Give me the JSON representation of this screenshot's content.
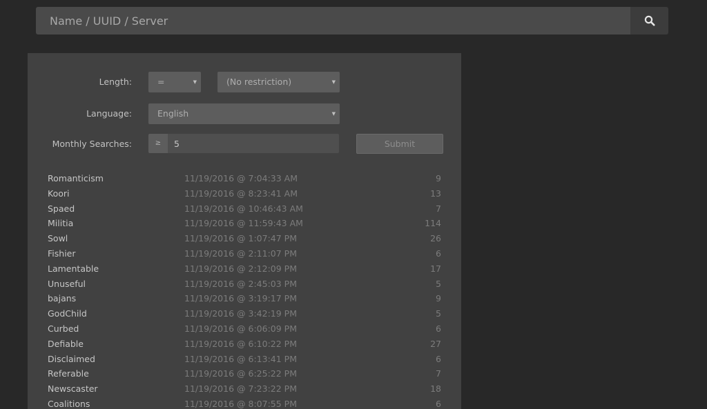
{
  "search": {
    "placeholder": "Name / UUID / Server",
    "icon": "search-icon"
  },
  "filters": {
    "length_label": "Length:",
    "length_operator": "=",
    "length_value": "(No restriction)",
    "language_label": "Language:",
    "language_value": "English",
    "monthly_label": "Monthly Searches:",
    "monthly_prefix": "≥",
    "monthly_value": "5",
    "submit_label": "Submit"
  },
  "results": [
    {
      "word": "Romanticism",
      "date": "11/19/2016 @ 7:04:33 AM",
      "count": "9"
    },
    {
      "word": "Koori",
      "date": "11/19/2016 @ 8:23:41 AM",
      "count": "13"
    },
    {
      "word": "Spaed",
      "date": "11/19/2016 @ 10:46:43 AM",
      "count": "7"
    },
    {
      "word": "Militia",
      "date": "11/19/2016 @ 11:59:43 AM",
      "count": "114"
    },
    {
      "word": "Sowl",
      "date": "11/19/2016 @ 1:07:47 PM",
      "count": "26"
    },
    {
      "word": "Fishier",
      "date": "11/19/2016 @ 2:11:07 PM",
      "count": "6"
    },
    {
      "word": "Lamentable",
      "date": "11/19/2016 @ 2:12:09 PM",
      "count": "17"
    },
    {
      "word": "Unuseful",
      "date": "11/19/2016 @ 2:45:03 PM",
      "count": "5"
    },
    {
      "word": "bajans",
      "date": "11/19/2016 @ 3:19:17 PM",
      "count": "9"
    },
    {
      "word": "GodChild",
      "date": "11/19/2016 @ 3:42:19 PM",
      "count": "5"
    },
    {
      "word": "Curbed",
      "date": "11/19/2016 @ 6:06:09 PM",
      "count": "6"
    },
    {
      "word": "Defiable",
      "date": "11/19/2016 @ 6:10:22 PM",
      "count": "27"
    },
    {
      "word": "Disclaimed",
      "date": "11/19/2016 @ 6:13:41 PM",
      "count": "6"
    },
    {
      "word": "Referable",
      "date": "11/19/2016 @ 6:25:22 PM",
      "count": "7"
    },
    {
      "word": "Newscaster",
      "date": "11/19/2016 @ 7:23:22 PM",
      "count": "18"
    },
    {
      "word": "Coalitions",
      "date": "11/19/2016 @ 8:07:55 PM",
      "count": "6"
    }
  ]
}
